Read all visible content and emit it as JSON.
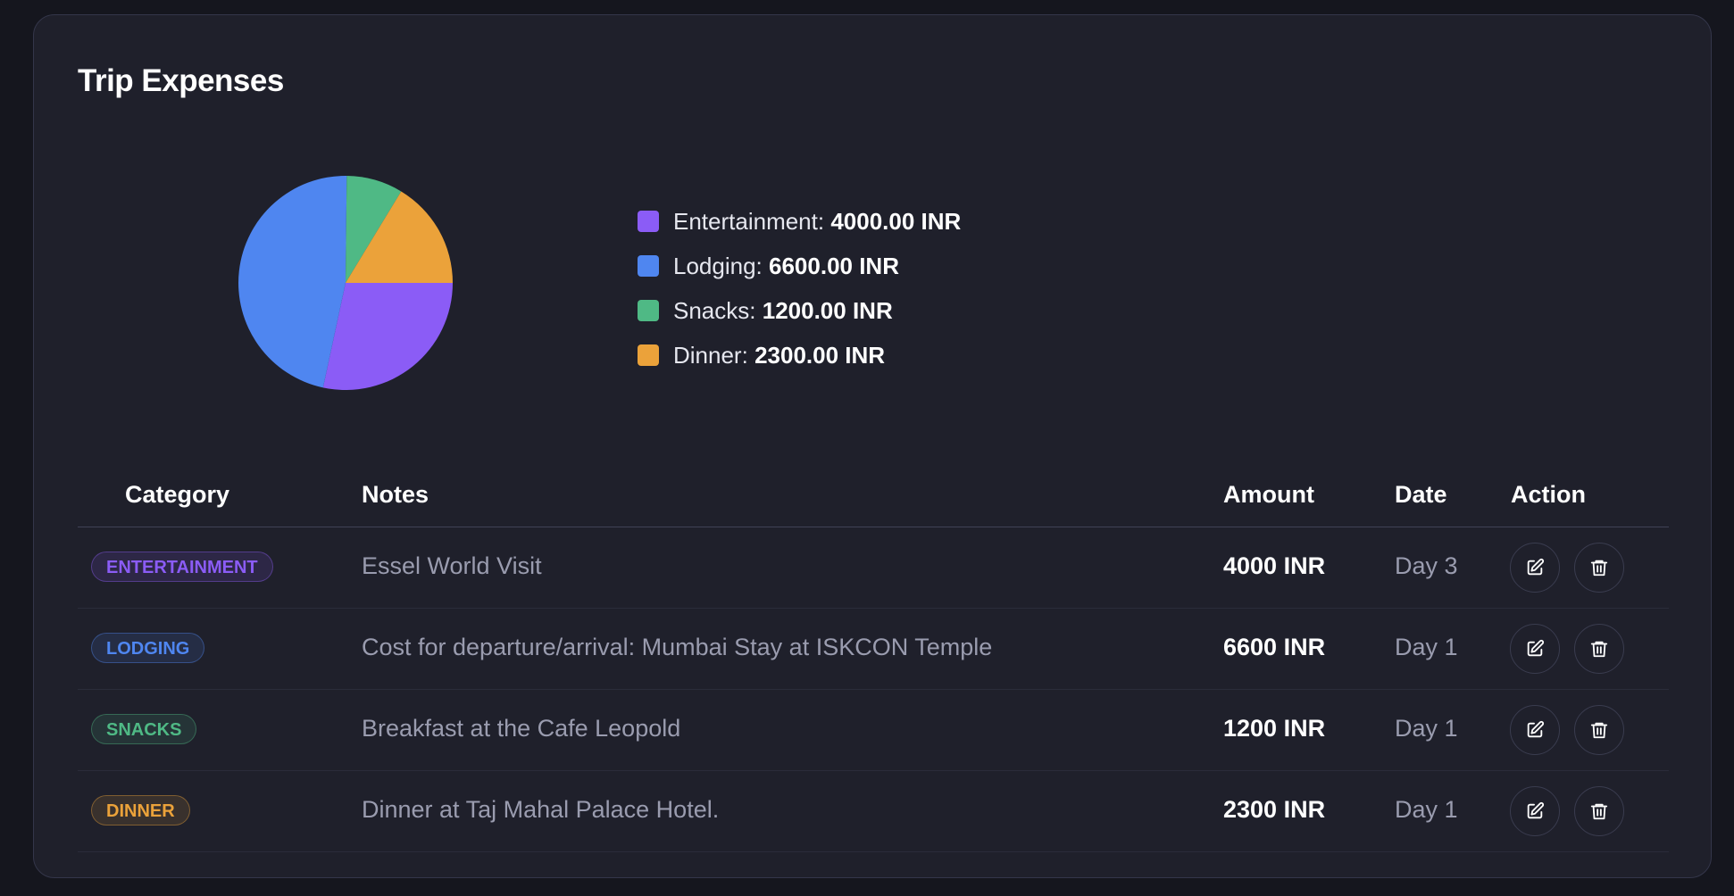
{
  "page": {
    "title": "Trip Expenses"
  },
  "colors": {
    "entertainment": "#8b5cf6",
    "lodging": "#4f86f0",
    "snacks": "#4fb985",
    "dinner": "#eba23a"
  },
  "chart_data": {
    "type": "pie",
    "categories": [
      "Entertainment",
      "Lodging",
      "Snacks",
      "Dinner"
    ],
    "values": [
      4000,
      6600,
      1200,
      2300
    ],
    "colors": [
      "#8b5cf6",
      "#4f86f0",
      "#4fb985",
      "#eba23a"
    ],
    "title": "",
    "legend": "right"
  },
  "legend": [
    {
      "name": "Entertainment:",
      "value": "4000.00 INR"
    },
    {
      "name": "Lodging:",
      "value": "6600.00 INR"
    },
    {
      "name": "Snacks:",
      "value": "1200.00 INR"
    },
    {
      "name": "Dinner:",
      "value": "2300.00 INR"
    }
  ],
  "table": {
    "headers": {
      "category": "Category",
      "notes": "Notes",
      "amount": "Amount",
      "date": "Date",
      "action": "Action"
    },
    "rows": [
      {
        "category": "ENTERTAINMENT",
        "notes": "Essel World Visit",
        "amount": "4000 INR",
        "date": "Day 3"
      },
      {
        "category": "LODGING",
        "notes": "Cost for departure/arrival: Mumbai Stay at ISKCON Temple",
        "amount": "6600 INR",
        "date": "Day 1"
      },
      {
        "category": "SNACKS",
        "notes": "Breakfast at the Cafe Leopold",
        "amount": "1200 INR",
        "date": "Day 1"
      },
      {
        "category": "DINNER",
        "notes": "Dinner at Taj Mahal Palace Hotel.",
        "amount": "2300 INR",
        "date": "Day 1"
      }
    ],
    "icons": {
      "edit": "edit-icon",
      "delete": "trash-icon"
    }
  }
}
